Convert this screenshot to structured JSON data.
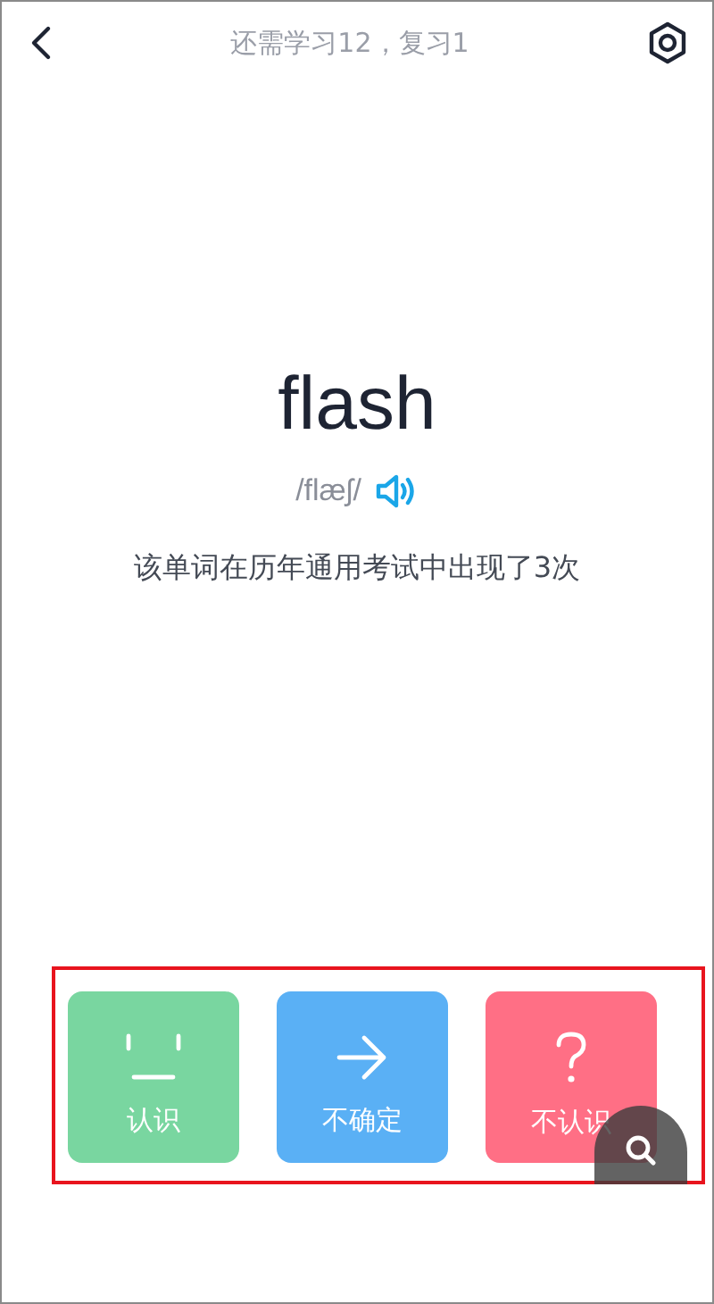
{
  "header": {
    "title": "还需学习12，复习1"
  },
  "word": {
    "text": "flash",
    "phonetic": "/flæʃ/"
  },
  "frequency": "该单词在历年通用考试中出现了3次",
  "answers": [
    {
      "kind": "smile",
      "label": "认识",
      "color": "#79d6a0"
    },
    {
      "kind": "arrow",
      "label": "不确定",
      "color": "#5ab0f5"
    },
    {
      "kind": "question",
      "label": "不认识",
      "color": "#ff6f85"
    }
  ]
}
